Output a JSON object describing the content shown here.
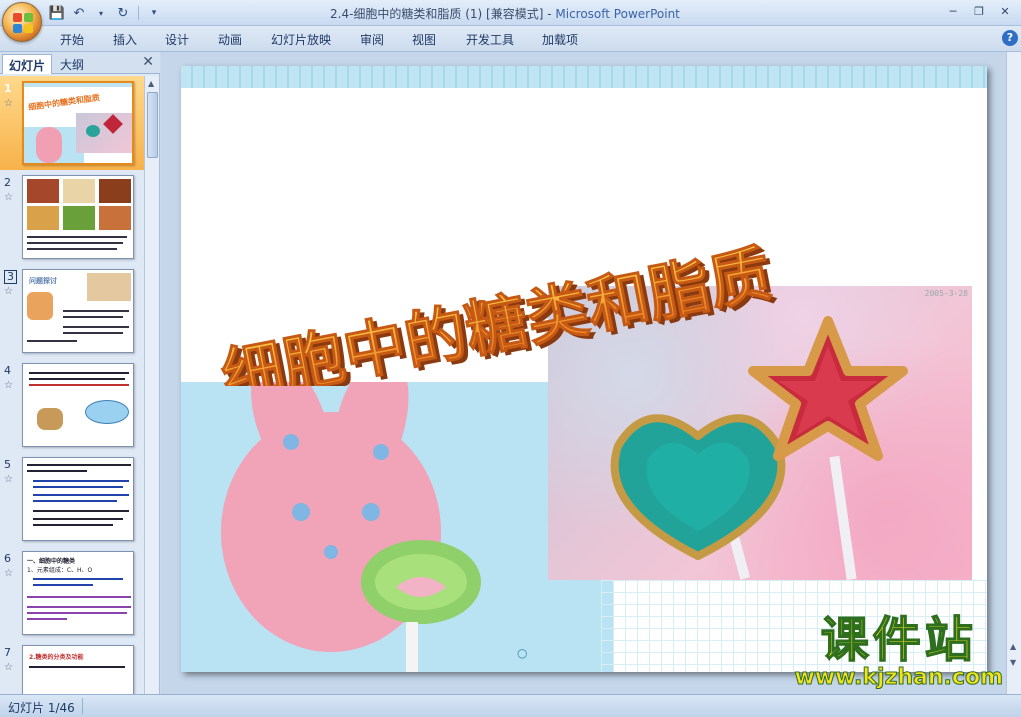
{
  "window": {
    "title": "2.4-细胞中的糖类和脂质 (1) [兼容模式] - Microsoft PowerPoint",
    "title_doc": "2.4-细胞中的糖类和脂质 (1) [兼容模式] - ",
    "title_app": "Microsoft PowerPoint"
  },
  "ribbon": {
    "tabs": [
      "开始",
      "插入",
      "设计",
      "动画",
      "幻灯片放映",
      "审阅",
      "视图",
      "开发工具",
      "加载项"
    ]
  },
  "left_pane": {
    "tabs": [
      "幻灯片",
      "大纲"
    ],
    "close_symbol": "✕",
    "slides": [
      {
        "num": "1",
        "selected": true
      },
      {
        "num": "2"
      },
      {
        "num": "3",
        "boxed": true
      },
      {
        "num": "4"
      },
      {
        "num": "5"
      },
      {
        "num": "6"
      },
      {
        "num": "7"
      }
    ],
    "star_glyph": "☆"
  },
  "slide": {
    "title": "细胞中的糖类和脂质",
    "photo_stamp": "2005-3-28"
  },
  "thumb_texts": {
    "slide1_title": "细胞中的糖类和脂质",
    "slide3_title": "问题探讨",
    "slide6_title": "一、细胞中的糖类",
    "slide6_sub": "1、元素组成：C、H、O",
    "slide7_title": "2.糖类的分类及功能"
  },
  "watermark": {
    "cn": "课件站",
    "url": "www.kjzhan.com"
  },
  "status_bar": {
    "slide_counter": "幻灯片 1/46"
  },
  "colors": {
    "accent_orange": "#f7b24b",
    "title_text": "#e8701c",
    "watermark": "#f4e21c"
  }
}
